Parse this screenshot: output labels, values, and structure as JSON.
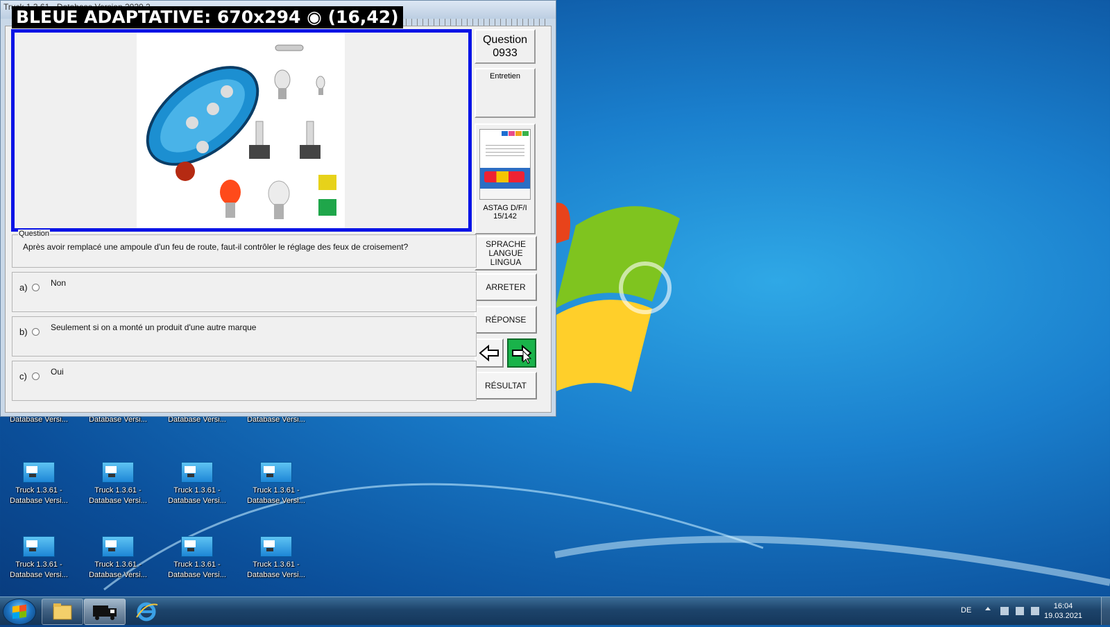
{
  "window": {
    "titlebar_text": "Truck 1.3.61 - Database Version 2020.2",
    "overlay_title": "BLEUE ADAPTATIVE: 670x294 ◉ (16,42)"
  },
  "side": {
    "question_label": "Question",
    "question_number": "0933",
    "category": "Entretien",
    "book_source": "ASTAG D/F/I",
    "book_page": "15/142"
  },
  "question": {
    "legend": "Question",
    "text": "Après avoir remplacé une ampoule d'un feu de route, faut-il contrôler le réglage des feux de croisement?"
  },
  "answers": [
    {
      "letter": "a)",
      "text": "Non"
    },
    {
      "letter": "b)",
      "text": "Seulement si on a monté un produit d'une autre marque"
    },
    {
      "letter": "c)",
      "text": "Oui"
    }
  ],
  "buttons": {
    "lang_1": "SPRACHE",
    "lang_2": "LANGUE",
    "lang_3": "LINGUA",
    "stop": "ARRETER",
    "answer": "RÉPONSE",
    "result": "RÉSULTAT"
  },
  "desktop_icons": [
    {
      "line1": "",
      "line2": "Database Versi..."
    },
    {
      "line1": "",
      "line2": "Database Versi..."
    },
    {
      "line1": "",
      "line2": "Database Versi..."
    },
    {
      "line1": "",
      "line2": "Database Versi..."
    },
    {
      "line1": "Truck 1.3.61 -",
      "line2": "Database Versi..."
    },
    {
      "line1": "Truck 1.3.61 -",
      "line2": "Database Versi..."
    },
    {
      "line1": "Truck 1.3.61 -",
      "line2": "Database Versi..."
    },
    {
      "line1": "Truck 1.3.61 -",
      "line2": "Database Versi..."
    },
    {
      "line1": "Truck 1.3.61 -",
      "line2": "Database Versi..."
    },
    {
      "line1": "Truck 1.3.61 -",
      "line2": "Database Versi..."
    },
    {
      "line1": "Truck 1.3.61 -",
      "line2": "Database Versi..."
    },
    {
      "line1": "Truck 1.3.61 -",
      "line2": "Database Versi..."
    }
  ],
  "taskbar": {
    "language": "DE",
    "time": "16:04",
    "date": "19.03.2021"
  },
  "colors": {
    "image_frame": "#0a14e6",
    "next_button": "#19b34a"
  }
}
